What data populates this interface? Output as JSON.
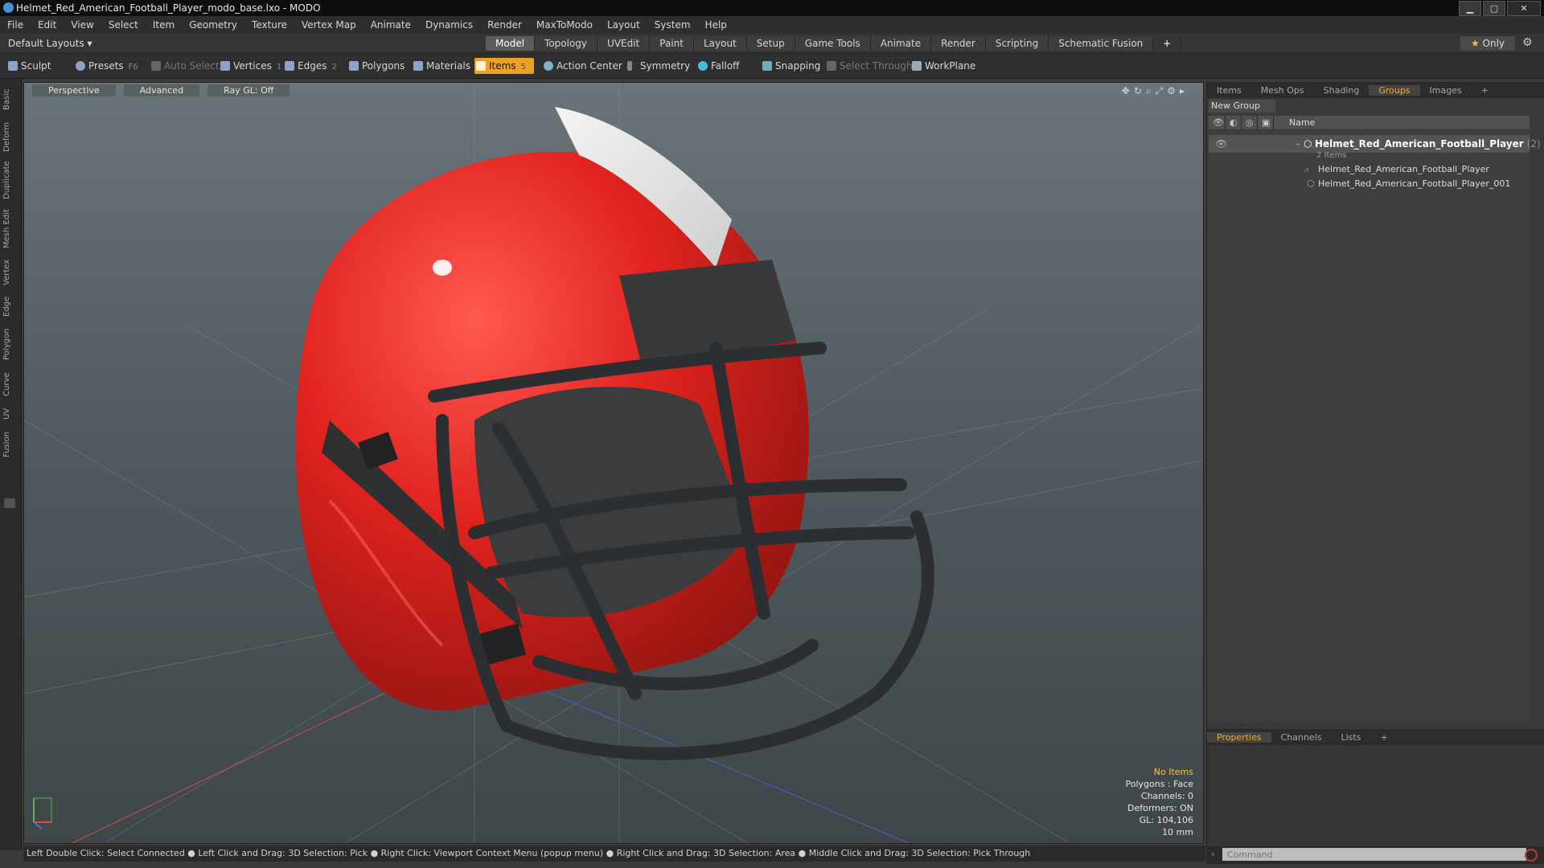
{
  "window": {
    "title": "Helmet_Red_American_Football_Player_modo_base.lxo - MODO"
  },
  "menu": [
    "File",
    "Edit",
    "View",
    "Select",
    "Item",
    "Geometry",
    "Texture",
    "Vertex Map",
    "Animate",
    "Dynamics",
    "Render",
    "MaxToModo",
    "Layout",
    "System",
    "Help"
  ],
  "layout": {
    "default_layouts": "Default Layouts ▾",
    "tabs": [
      "Model",
      "Topology",
      "UVEdit",
      "Paint",
      "Layout",
      "Setup",
      "Game Tools",
      "Animate",
      "Render",
      "Scripting",
      "Schematic Fusion"
    ],
    "active_tab": "Model",
    "only_label": "Only",
    "only_star": "★"
  },
  "toolbar": {
    "sculpt": "Sculpt",
    "presets": "Presets",
    "presets_key": "F6",
    "auto_select": "Auto Select",
    "vertices": "Vertices",
    "vertices_key": "1",
    "edges": "Edges",
    "edges_key": "2",
    "polygons": "Polygons",
    "materials": "Materials",
    "items": "Items",
    "items_key": "5",
    "action_center": "Action Center",
    "symmetry": "Symmetry",
    "falloff": "Falloff",
    "snapping": "Snapping",
    "select_through": "Select Through",
    "workplane": "WorkPlane"
  },
  "left_tabs": [
    "Basic",
    "Deform",
    "Duplicate",
    "Mesh Edit",
    "Vertex",
    "Edge",
    "Polygon",
    "Curve",
    "UV",
    "Fusion"
  ],
  "viewport": {
    "view": "Perspective",
    "shading": "Advanced",
    "raygl": "Ray GL: Off",
    "info": {
      "no_items": "No Items",
      "polygons": "Polygons : Face",
      "channels": "Channels: 0",
      "deformers": "Deformers: ON",
      "gl": "GL: 104,106",
      "scale": "10 mm"
    }
  },
  "status": "Left Double Click: Select Connected ● Left Click and Drag: 3D Selection: Pick ● Right Click: Viewport Context Menu (popup menu) ● Right Click and Drag: 3D Selection: Area ● Middle Click and Drag: 3D Selection: Pick Through",
  "groups_panel": {
    "tabs": [
      "Items",
      "Mesh Ops",
      "Shading",
      "Groups",
      "Images",
      "+"
    ],
    "active_tab": "Groups",
    "new_group": "New Group",
    "column_name": "Name",
    "group": {
      "name": "Helmet_Red_American_Football_Player",
      "count": "(2)",
      "sub": "2 Items"
    },
    "children": [
      "Helmet_Red_American_Football_Player",
      "Helmet_Red_American_Football_Player_001"
    ]
  },
  "properties_panel": {
    "tabs": [
      "Properties",
      "Channels",
      "Lists",
      "+"
    ],
    "active_tab": "Properties"
  },
  "command": {
    "placeholder": "Command"
  },
  "colors": {
    "accent": "#e9a226",
    "helmet_red": "#e0231f",
    "facemask": "#2c2f31"
  }
}
